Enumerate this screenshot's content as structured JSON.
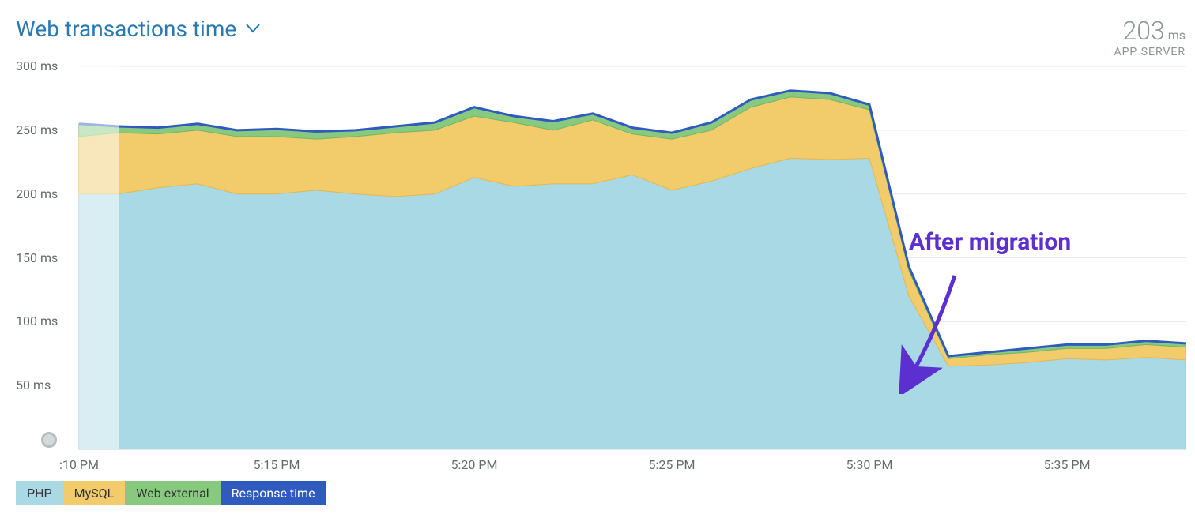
{
  "title": "Web transactions time",
  "summary_value": "203",
  "summary_unit": "ms",
  "summary_sub": "APP SERVER",
  "annotation_text": "After migration",
  "legend": [
    {
      "name": "PHP",
      "color": "#a8d9e5"
    },
    {
      "name": "MySQL",
      "color": "#f2cb6a"
    },
    {
      "name": "Web external",
      "color": "#87c97f"
    },
    {
      "name": "Response time",
      "color": "#2f5bbf",
      "text_color": "#ffffff"
    }
  ],
  "chart_data": {
    "type": "area",
    "xlabel": "",
    "ylabel": "",
    "ylim": [
      0,
      300
    ],
    "y_unit": "ms",
    "x_ticks": [
      ":10 PM",
      "5:15 PM",
      "5:20 PM",
      "5:25 PM",
      "5:30 PM",
      "5:35 PM"
    ],
    "y_ticks": [
      "50 ms",
      "100 ms",
      "150 ms",
      "200 ms",
      "250 ms",
      "300 ms"
    ],
    "x_tick_positions_min": [
      0,
      5,
      10,
      15,
      20,
      25
    ],
    "categories_minutes_from_510pm": [
      0,
      1,
      2,
      3,
      4,
      5,
      6,
      7,
      8,
      9,
      10,
      11,
      12,
      13,
      14,
      15,
      16,
      17,
      18,
      19,
      20,
      21,
      22,
      23,
      24,
      25,
      26,
      27,
      28
    ],
    "series": [
      {
        "name": "PHP",
        "values": [
          200,
          200,
          205,
          208,
          200,
          200,
          203,
          200,
          198,
          200,
          213,
          206,
          208,
          208,
          215,
          203,
          210,
          220,
          228,
          227,
          228,
          120,
          65,
          66,
          68,
          71,
          70,
          72,
          70
        ]
      },
      {
        "name": "MySQL",
        "values": [
          45,
          48,
          42,
          42,
          45,
          45,
          40,
          45,
          50,
          50,
          48,
          50,
          42,
          50,
          32,
          40,
          40,
          48,
          48,
          47,
          38,
          20,
          6,
          8,
          8,
          8,
          9,
          10,
          10
        ]
      },
      {
        "name": "Web external",
        "values": [
          10,
          5,
          5,
          5,
          5,
          6,
          6,
          5,
          5,
          6,
          7,
          5,
          7,
          5,
          5,
          5,
          6,
          6,
          5,
          5,
          4,
          3,
          2,
          2,
          3,
          3,
          3,
          3,
          3
        ]
      }
    ],
    "response_time_line": [
      255,
      253,
      252,
      255,
      250,
      251,
      249,
      250,
      253,
      256,
      268,
      261,
      257,
      263,
      252,
      248,
      256,
      274,
      281,
      279,
      270,
      143,
      73,
      76,
      79,
      82,
      82,
      85,
      83
    ]
  }
}
